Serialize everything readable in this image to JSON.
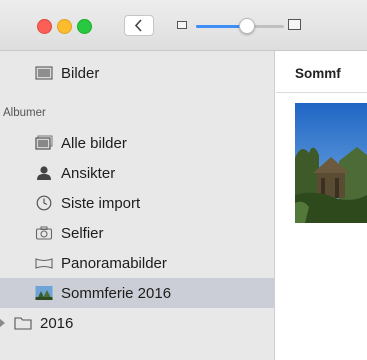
{
  "toolbar": {
    "window_controls": [
      "close",
      "minimize",
      "zoom"
    ],
    "back_icon": "chevron-left-icon",
    "zoom_slider": {
      "value": 0.58
    }
  },
  "sidebar": {
    "top_item": {
      "label": "Bilder",
      "icon": "photos-library-icon"
    },
    "section_header": "Albumer",
    "items": [
      {
        "label": "Alle bilder",
        "icon": "all-photos-icon"
      },
      {
        "label": "Ansikter",
        "icon": "person-icon"
      },
      {
        "label": "Siste import",
        "icon": "clock-icon"
      },
      {
        "label": "Selfier",
        "icon": "camera-icon"
      },
      {
        "label": "Panoramabilder",
        "icon": "panorama-icon"
      },
      {
        "label": "Sommferie 2016",
        "icon": "album-thumbnail-icon",
        "selected": true
      },
      {
        "label": "2016",
        "icon": "folder-icon",
        "disclosure": "collapsed"
      }
    ]
  },
  "content": {
    "title": "Sommf"
  },
  "colors": {
    "sidebar_bg": "#e8e8e8",
    "selection": "#cbced6",
    "accent": "#3e8ef7"
  }
}
